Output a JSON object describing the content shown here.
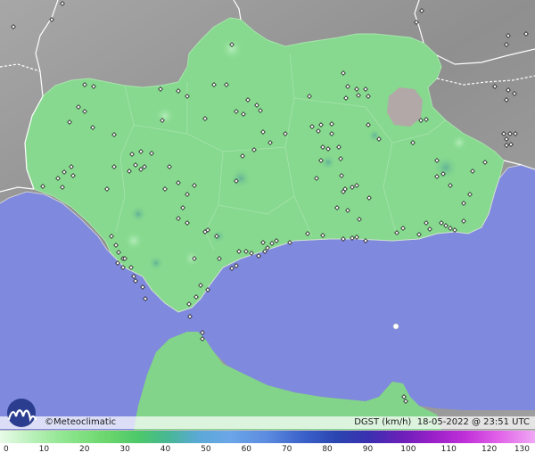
{
  "credit": "©Meteoclimatic",
  "variable": "DGST (km/h)",
  "timestamp": "18-05-2022 @ 23:51 UTC",
  "legend": {
    "ticks": [
      "0",
      "10",
      "20",
      "30",
      "40",
      "50",
      "60",
      "70",
      "80",
      "90",
      "100",
      "110",
      "120",
      "130"
    ]
  },
  "colors": {
    "sea": "#7f89dd",
    "land_outside": "#9a9a9a",
    "region_fill": "#86d98e",
    "station_marker": "#ffffff"
  }
}
